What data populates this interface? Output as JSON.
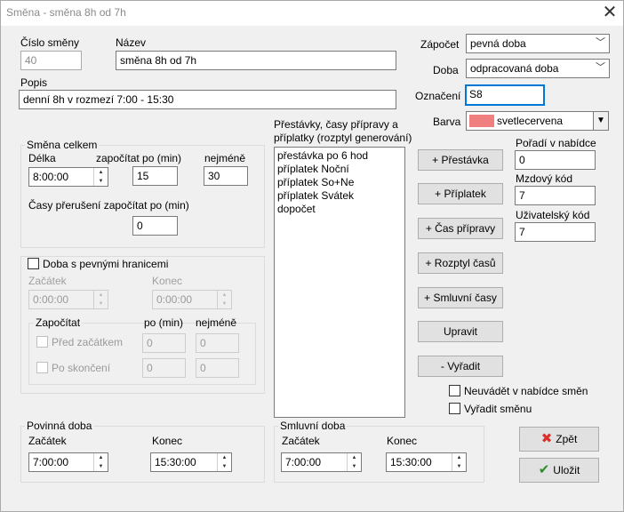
{
  "window": {
    "title": "Směna - směna 8h od 7h"
  },
  "header": {
    "cislo_label": "Číslo směny",
    "cislo_value": "40",
    "nazev_label": "Název",
    "nazev_value": "směna 8h od 7h",
    "popis_label": "Popis",
    "popis_value": "denní 8h v rozmezí 7:00 - 15:30"
  },
  "right": {
    "zapocet_label": "Zápočet",
    "zapocet_value": "pevná doba",
    "doba_label": "Doba",
    "doba_value": "odpracovaná doba",
    "oznaceni_label": "Označení",
    "oznaceni_value": "S8",
    "barva_label": "Barva",
    "barva_value": "svetlecervena",
    "barva_color": "#f08080",
    "poradi_label": "Pořadí v nabídce",
    "poradi_value": "0",
    "mzdovy_label": "Mzdový kód",
    "mzdovy_value": "7",
    "uzivatelsky_label": "Uživatelský kód",
    "uzivatelsky_value": "7"
  },
  "smena_celkem": {
    "title": "Směna celkem",
    "delka_label": "Délka",
    "delka_value": "8:00:00",
    "zapocitat_label": "započítat po (min)",
    "zapocitat_value": "15",
    "nejmene_label": "nejméně",
    "nejmene_value": "30",
    "preruseni_label": "Časy přerušení započítat po (min)",
    "preruseni_value": "0"
  },
  "pevne_hranice": {
    "checkbox_label": "Doba s pevnými hranicemi",
    "zacatek_label": "Začátek",
    "zacatek_value": "0:00:00",
    "konec_label": "Konec",
    "konec_value": "0:00:00",
    "zapocitat_label": "Započítat",
    "po_min_label": "po (min)",
    "nejmene_label": "nejméně",
    "pred_label": "Před začátkem",
    "pred_po": "0",
    "pred_nejmene": "0",
    "po_label": "Po skončení",
    "po_po": "0",
    "po_nejmene": "0"
  },
  "prestavky": {
    "title_line1": "Přestávky, časy přípravy a",
    "title_line2": "příplatky (rozptyl generování)",
    "items": [
      "přestávka po 6 hod",
      "příplatek Noční",
      "příplatek So+Ne",
      "příplatek Svátek",
      "dopočet"
    ]
  },
  "buttons": {
    "prestavka": "+ Přestávka",
    "priplatek": "+ Příplatek",
    "cas_pripravy": "+ Čas přípravy",
    "rozptyl": "+ Rozptyl časů",
    "smluvni": "+ Smluvní časy",
    "upravit": "Upravit",
    "vyradit": "- Vyřadit",
    "zpet": "Zpět",
    "ulozit": "Uložit"
  },
  "checks": {
    "neuvadet": "Neuvádět v nabídce směn",
    "vyradit_smenu": "Vyřadit směnu"
  },
  "povinna": {
    "title": "Povinná doba",
    "zacatek_label": "Začátek",
    "zacatek_value": "7:00:00",
    "konec_label": "Konec",
    "konec_value": "15:30:00"
  },
  "smluvni": {
    "title": "Smluvní doba",
    "zacatek_label": "Začátek",
    "zacatek_value": "7:00:00",
    "konec_label": "Konec",
    "konec_value": "15:30:00"
  }
}
